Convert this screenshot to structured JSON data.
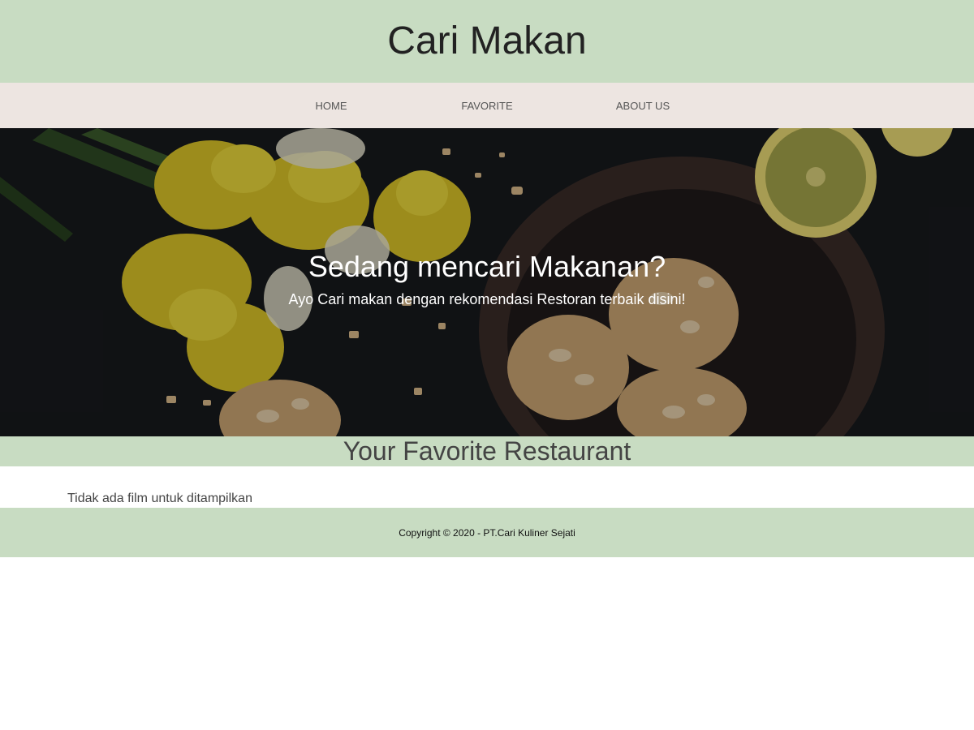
{
  "app_bar": {
    "title": "Cari Makan"
  },
  "nav": {
    "items": [
      {
        "label": "HOME"
      },
      {
        "label": "FAVORITE"
      },
      {
        "label": "ABOUT US"
      }
    ]
  },
  "hero": {
    "title": "Sedang mencari Makanan?",
    "tagline": "Ayo Cari makan dengan rekomendasi Restoran terbaik disini!"
  },
  "main": {
    "heading": "Your Favorite Restaurant",
    "empty_message": "Tidak ada film untuk ditampilkan"
  },
  "footer": {
    "copyright": "Copyright © 2020 - PT.Cari Kuliner Sejati"
  },
  "colors": {
    "accent_green": "#c8dcc2",
    "nav_background": "#ede5e1"
  }
}
